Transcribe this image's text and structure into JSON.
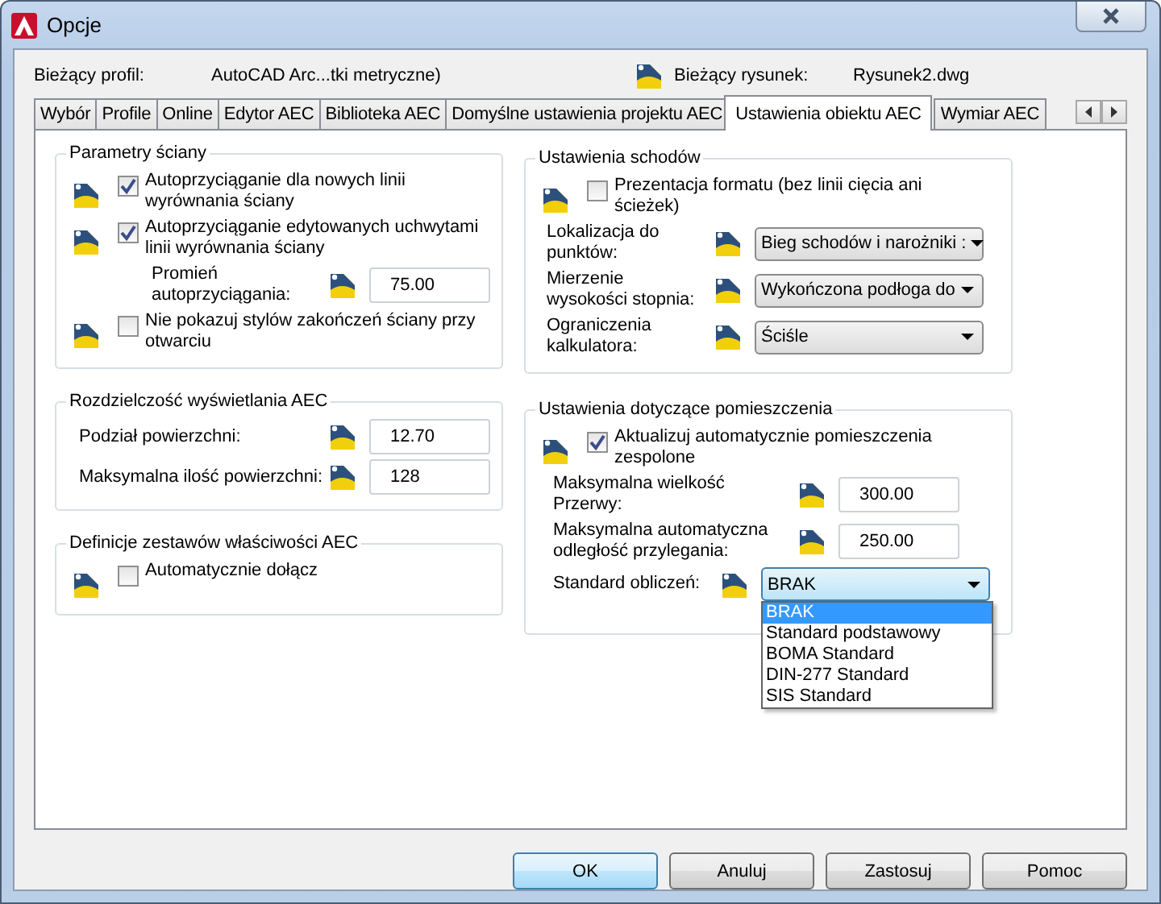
{
  "window": {
    "title": "Opcje"
  },
  "header": {
    "profile_label": "Bieżący profil:",
    "profile_value": "AutoCAD Arc...tki metryczne)",
    "drawing_label": "Bieżący rysunek:",
    "drawing_value": "Rysunek2.dwg"
  },
  "tabs": [
    {
      "label": "Wybór",
      "selected": false
    },
    {
      "label": "Profile",
      "selected": false
    },
    {
      "label": "Online",
      "selected": false
    },
    {
      "label": "Edytor AEC",
      "selected": false
    },
    {
      "label": "Biblioteka AEC",
      "selected": false
    },
    {
      "label": "Domyślne ustawienia projektu AEC",
      "selected": false
    },
    {
      "label": "Ustawienia obiektu AEC",
      "selected": true
    },
    {
      "label": "Wymiar AEC",
      "selected": false
    }
  ],
  "left_groups": [
    {
      "title": "Parametry ściany",
      "items": [
        {
          "kind": "checkbox",
          "label": "Autoprzyciąganie dla nowych linii wyrównania ściany",
          "checked": true
        },
        {
          "kind": "checkbox",
          "label": "Autoprzyciąganie edytowanych uchwytami linii wyrównania ściany",
          "checked": true
        },
        {
          "kind": "field",
          "label": "Promień autoprzyciągania:",
          "value": "75.00"
        },
        {
          "kind": "checkbox",
          "label": "Nie pokazuj stylów zakończeń ściany przy otwarciu",
          "checked": false
        }
      ]
    },
    {
      "title": "Rozdzielczość wyświetlania AEC",
      "items": [
        {
          "kind": "field",
          "label": "Podział powierzchni:",
          "value": "12.70"
        },
        {
          "kind": "field",
          "label": "Maksymalna ilość powierzchni:",
          "value": "128"
        }
      ]
    },
    {
      "title": "Definicje zestawów właściwości AEC",
      "items": [
        {
          "kind": "checkbox",
          "label": "Automatycznie dołącz",
          "checked": false
        }
      ]
    }
  ],
  "right_groups": [
    {
      "title": "Ustawienia schodów",
      "items": [
        {
          "kind": "checkbox",
          "label": "Prezentacja formatu (bez linii cięcia ani ścieżek)",
          "checked": false
        },
        {
          "kind": "select",
          "label": "Lokalizacja do punktów:",
          "value": "Bieg schodów i narożniki :",
          "expanded": false
        },
        {
          "kind": "select",
          "label": "Mierzenie wysokości stopnia:",
          "value": "Wykończona podłoga do",
          "expanded": false
        },
        {
          "kind": "select",
          "label": "Ograniczenia kalkulatora:",
          "value": "Ściśle",
          "expanded": false
        }
      ]
    },
    {
      "title": "Ustawienia dotyczące pomieszczenia",
      "items": [
        {
          "kind": "checkbox",
          "label": "Aktualizuj automatycznie pomieszczenia zespolone",
          "checked": true
        },
        {
          "kind": "field",
          "label": "Maksymalna wielkość Przerwy:",
          "value": "300.00"
        },
        {
          "kind": "field",
          "label": "Maksymalna automatyczna odległość przylegania:",
          "value": "250.00"
        },
        {
          "kind": "select",
          "label": "Standard obliczeń:",
          "value": "BRAK",
          "expanded": true,
          "options": [
            {
              "label": "BRAK",
              "selected": true
            },
            {
              "label": "Standard podstawowy",
              "selected": false
            },
            {
              "label": "BOMA Standard",
              "selected": false
            },
            {
              "label": "DIN-277 Standard",
              "selected": false
            },
            {
              "label": "SIS Standard",
              "selected": false
            }
          ]
        }
      ]
    }
  ],
  "buttons": [
    {
      "label": "OK",
      "default": true
    },
    {
      "label": "Anuluj",
      "default": false
    },
    {
      "label": "Zastosuj",
      "default": false
    },
    {
      "label": "Pomoc",
      "default": false
    }
  ]
}
